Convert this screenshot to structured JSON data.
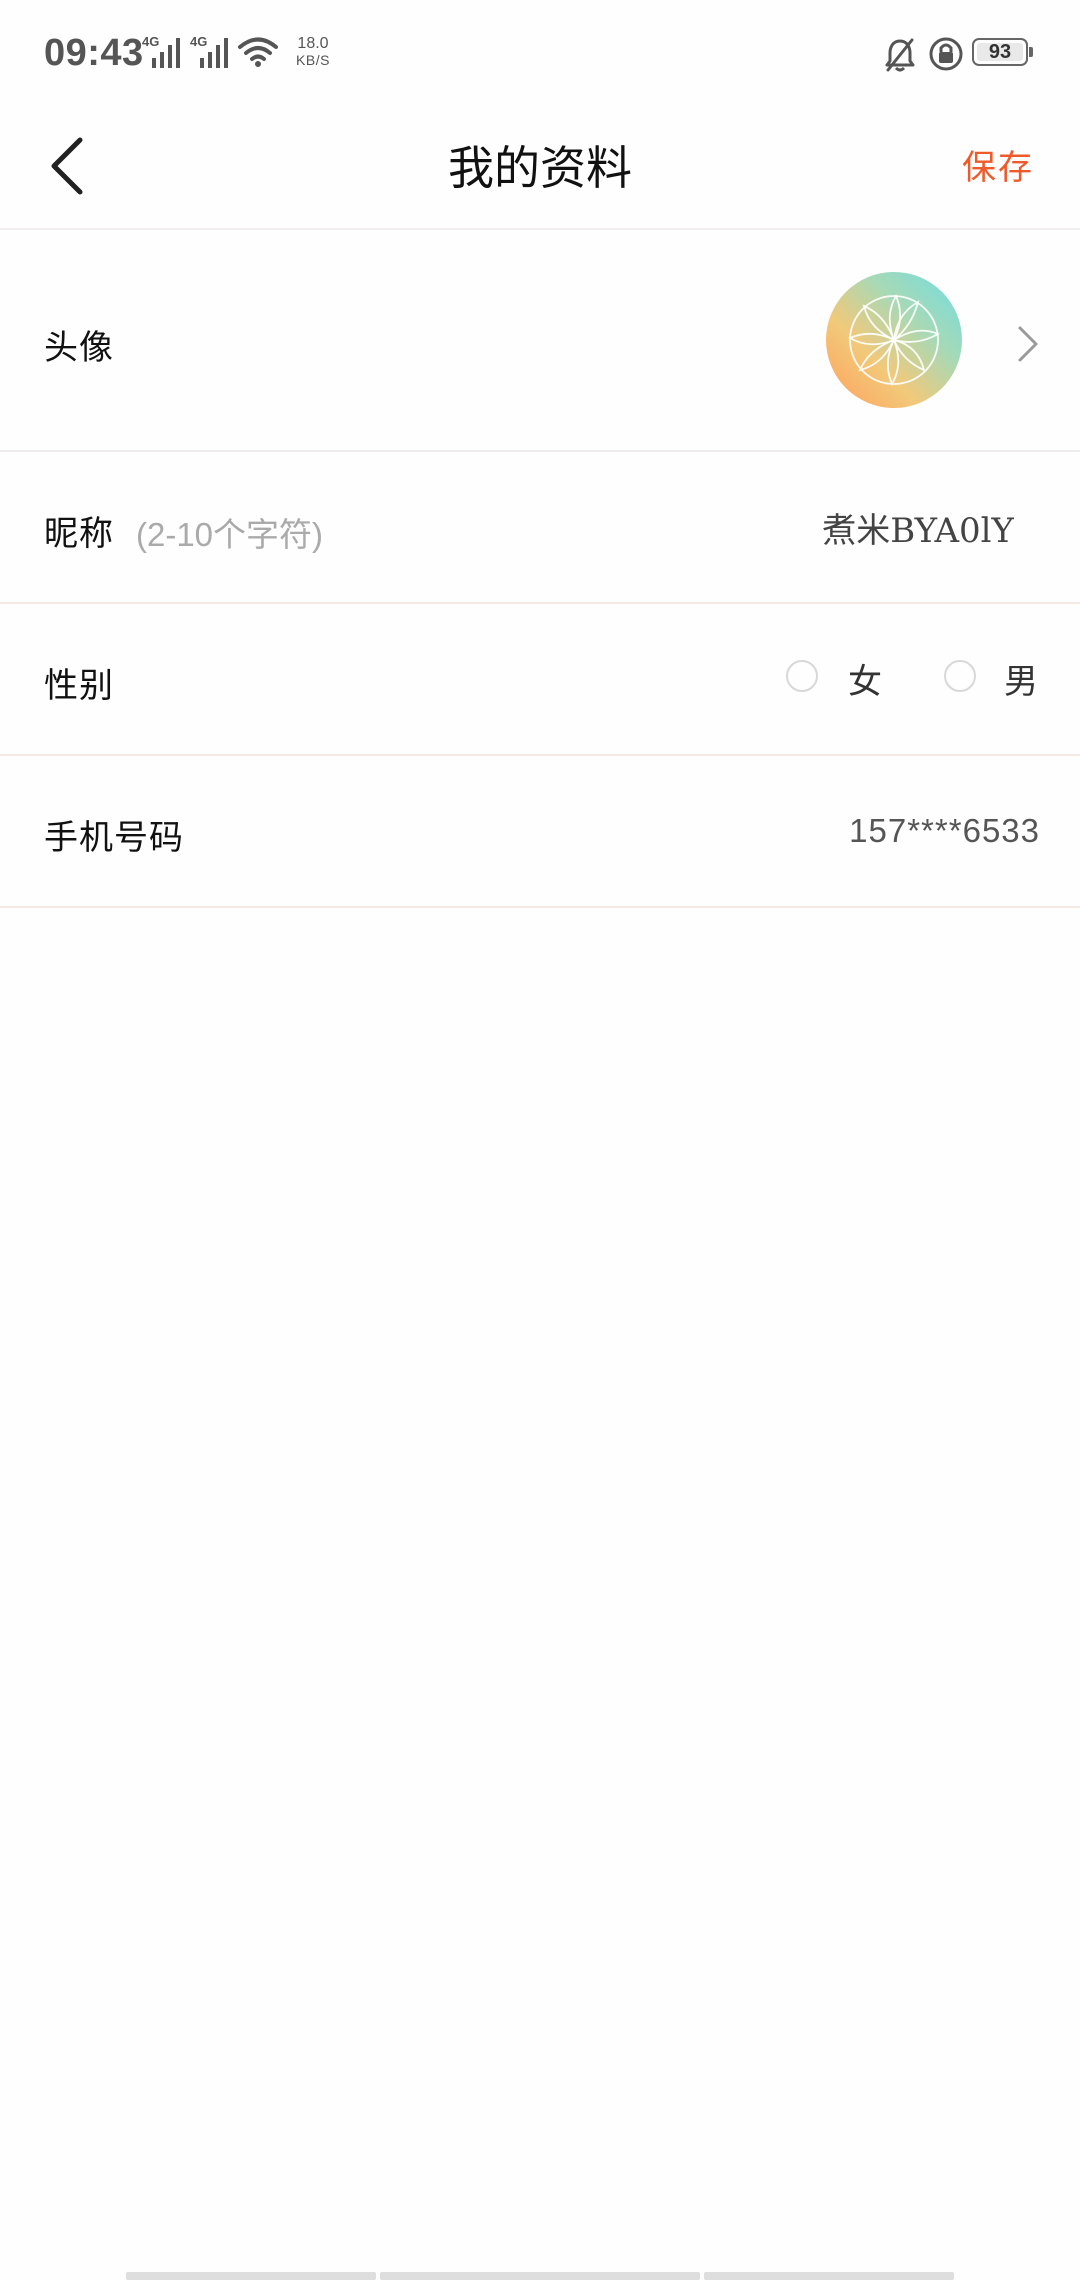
{
  "status_bar": {
    "time": "09:43",
    "sim1_tag": "4G",
    "sim2_tag": "4G",
    "net_speed_value": "18.0",
    "net_speed_unit": "KB/S",
    "battery": "93",
    "icons": [
      "signal-icon",
      "signal-icon",
      "wifi-icon",
      "mute-bell-icon",
      "rotation-lock-icon",
      "battery-icon"
    ]
  },
  "header": {
    "back_icon": "chevron-left-icon",
    "title": "我的资料",
    "save_label": "保存"
  },
  "profile": {
    "avatar_label": "头像",
    "nickname_label": "昵称",
    "nickname_hint": "(2-10个字符)",
    "nickname_value": "煮米BYA0lY",
    "gender_label": "性别",
    "gender_options": [
      "女",
      "男"
    ],
    "phone_label": "手机号码",
    "phone_value": "157****6533"
  },
  "colors": {
    "accent": "#ef5a2a",
    "divider": "#f7e8e5",
    "avatar_gradient": [
      "#6fdde3",
      "#f2c97a",
      "#ff9f5a"
    ]
  }
}
